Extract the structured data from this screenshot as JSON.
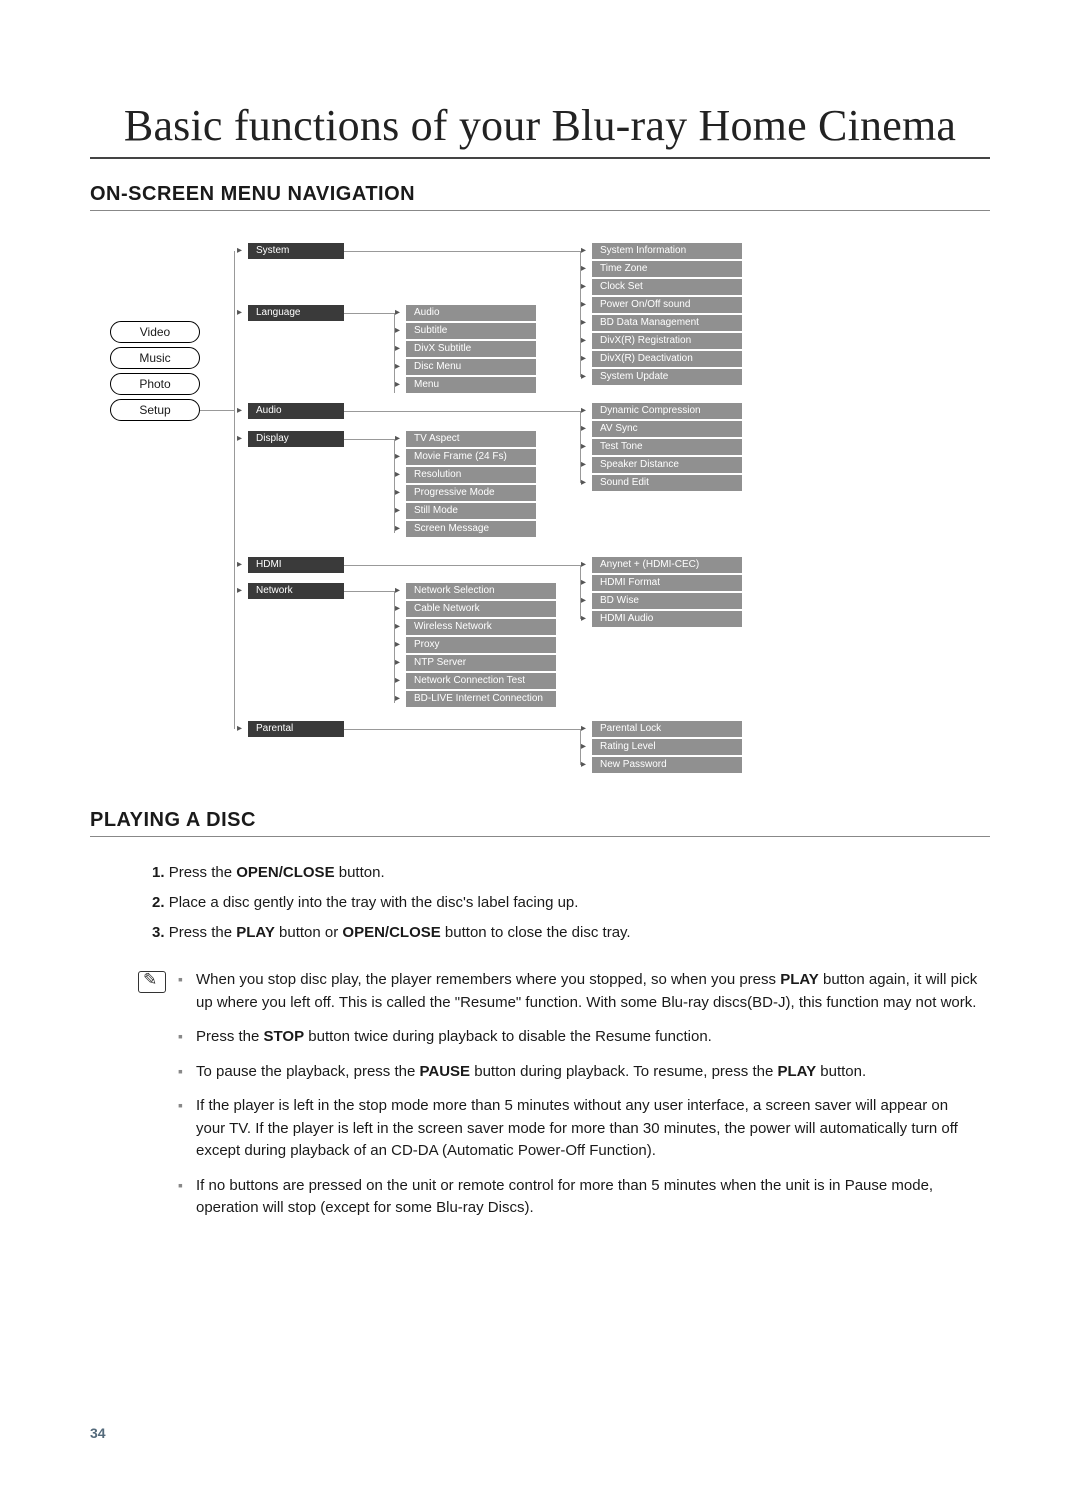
{
  "title": "Basic functions of your Blu-ray Home Cinema",
  "section1": "ON-SCREEN MENU NAVIGATION",
  "section2": "PLAYING A DISC",
  "page_number": "34",
  "main_tabs": [
    "Video",
    "Music",
    "Photo",
    "Setup"
  ],
  "setup_items": [
    "System",
    "Language",
    "Audio",
    "Display",
    "HDMI",
    "Network",
    "Parental"
  ],
  "language_sub": [
    "Audio",
    "Subtitle",
    "DivX Subtitle",
    "Disc Menu",
    "Menu"
  ],
  "display_sub": [
    "TV Aspect",
    "Movie Frame (24 Fs)",
    "Resolution",
    "Progressive Mode",
    "Still Mode",
    "Screen Message"
  ],
  "network_sub": [
    "Network Selection",
    "Cable Network",
    "Wireless Network",
    "Proxy",
    "NTP Server",
    "Network Connection Test",
    "BD-LIVE Internet Connection"
  ],
  "system_sub": [
    "System Information",
    "Time Zone",
    "Clock Set",
    "Power On/Off sound",
    "BD Data Management",
    "DivX(R) Registration",
    "DivX(R) Deactivation",
    "System Update"
  ],
  "audio_sub": [
    "Dynamic Compression",
    "AV Sync",
    "Test Tone",
    "Speaker Distance",
    "Sound Edit"
  ],
  "hdmi_sub": [
    "Anynet + (HDMI-CEC)",
    "HDMI Format",
    "BD Wise",
    "HDMI Audio"
  ],
  "parental_sub": [
    "Parental Lock",
    "Rating Level",
    "New Password"
  ],
  "play": {
    "n1": "1.",
    "t1a": "Press the ",
    "t1b": "OPEN/CLOSE",
    "t1c": " button.",
    "n2": "2.",
    "t2": "Place a disc gently into the tray with the disc's label facing up.",
    "n3": "3.",
    "t3a": "Press the ",
    "t3b": "PLAY",
    "t3c": " button or ",
    "t3d": "OPEN/CLOSE",
    "t3e": " button to close the disc tray."
  },
  "notes": {
    "a1": "When you stop disc play, the player remembers where you stopped, so when you press ",
    "a2": "PLAY",
    "a3": " button again, it will pick up where you left off. This is called the \"Resume\" function. With some Blu-ray discs(BD-J), this function may not work.",
    "b1": "Press the ",
    "b2": "STOP",
    "b3": " button twice during playback to disable the Resume function.",
    "c1": "To pause the playback, press the ",
    "c2": "PAUSE",
    "c3": " button during playback. To resume, press the ",
    "c4": "PLAY",
    "c5": " button.",
    "d": "If the player is left in the stop mode more than 5 minutes without any user interface, a screen saver will appear on your TV. If the player is left in the screen saver mode for more than 30 minutes, the power will automatically turn off except during playback of an CD-DA (Automatic Power-Off Function).",
    "e": "If no buttons are pressed on the unit or remote control for more than 5 minutes when the unit is in Pause mode, operation will stop (except for some Blu-ray Discs)."
  }
}
